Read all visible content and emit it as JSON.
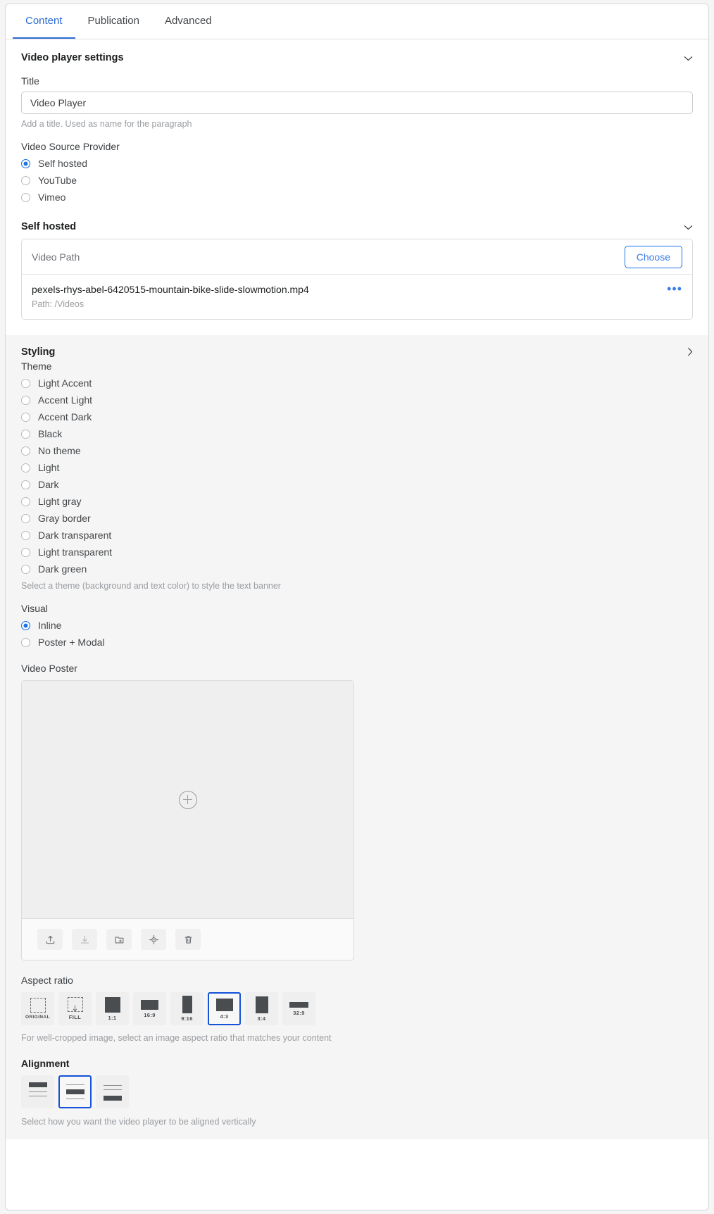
{
  "tabs": [
    {
      "label": "Content",
      "active": true
    },
    {
      "label": "Publication",
      "active": false
    },
    {
      "label": "Advanced",
      "active": false
    }
  ],
  "video_player_settings": {
    "section_title": "Video player settings",
    "chevron": "down",
    "title_label": "Title",
    "title_value": "Video Player",
    "title_helper": "Add a title. Used as name for the paragraph",
    "provider_label": "Video Source Provider",
    "providers": [
      {
        "label": "Self hosted",
        "selected": true
      },
      {
        "label": "YouTube",
        "selected": false
      },
      {
        "label": "Vimeo",
        "selected": false
      }
    ]
  },
  "self_hosted": {
    "section_title": "Self hosted",
    "chevron": "down",
    "video_path_label": "Video Path",
    "choose_label": "Choose",
    "file_name": "pexels-rhys-abel-6420515-mountain-bike-slide-slowmotion.mp4",
    "file_path": "Path: /Videos",
    "more_label": "•••"
  },
  "styling": {
    "section_title": "Styling",
    "chevron": "right",
    "theme_label": "Theme",
    "themes": [
      {
        "label": "Light Accent",
        "selected": false
      },
      {
        "label": "Accent Light",
        "selected": false
      },
      {
        "label": "Accent Dark",
        "selected": false
      },
      {
        "label": "Black",
        "selected": false
      },
      {
        "label": "No theme",
        "selected": false
      },
      {
        "label": "Light",
        "selected": false
      },
      {
        "label": "Dark",
        "selected": false
      },
      {
        "label": "Light gray",
        "selected": false
      },
      {
        "label": "Gray border",
        "selected": false
      },
      {
        "label": "Dark transparent",
        "selected": false
      },
      {
        "label": "Light transparent",
        "selected": false
      },
      {
        "label": "Dark green",
        "selected": false
      }
    ],
    "theme_helper": "Select a theme (background and text color) to style the text banner",
    "visual_label": "Visual",
    "visuals": [
      {
        "label": "Inline",
        "selected": true
      },
      {
        "label": "Poster + Modal",
        "selected": false
      }
    ],
    "poster_label": "Video Poster",
    "poster_tools": [
      "upload-icon",
      "download-icon",
      "folder-add-icon",
      "focus-point-icon",
      "delete-icon"
    ],
    "aspect_ratio_label": "Aspect ratio",
    "aspect_ratios": [
      {
        "label": "ORIGINAL",
        "selected": false
      },
      {
        "label": "FILL",
        "selected": false
      },
      {
        "label": "1:1",
        "selected": false
      },
      {
        "label": "16:9",
        "selected": false
      },
      {
        "label": "9:16",
        "selected": false
      },
      {
        "label": "4:3",
        "selected": true
      },
      {
        "label": "3:4",
        "selected": false
      },
      {
        "label": "32:9",
        "selected": false
      }
    ],
    "aspect_ratio_helper": "For well-cropped image, select an image aspect ratio that matches your content",
    "alignment_label": "Alignment",
    "alignments": [
      {
        "name": "align-top",
        "selected": false
      },
      {
        "name": "align-middle",
        "selected": true
      },
      {
        "name": "align-bottom",
        "selected": false
      }
    ],
    "alignment_helper": "Select how you want the video player to be aligned vertically"
  },
  "colors": {
    "accent": "#1a73e8",
    "tab_active": "#2b6cd4",
    "selection_border": "#1552d8",
    "text": "#3c3f42",
    "muted": "#9a9da1"
  }
}
